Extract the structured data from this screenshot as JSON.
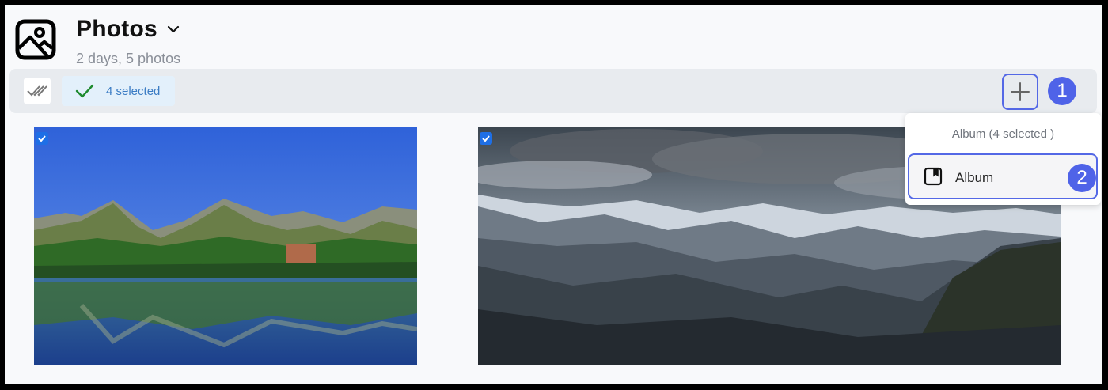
{
  "header": {
    "title": "Photos",
    "subtitle": "2 days, 5 photos",
    "app_icon": "image-icon",
    "chevron_icon": "chevron-down-icon"
  },
  "toolbar": {
    "select_all_icon": "double-check-icon",
    "selected_label": "4 selected",
    "selected_icon": "check-icon",
    "add_icon": "plus-icon",
    "step1_label": "1"
  },
  "dropdown": {
    "header": "Album (4 selected )",
    "items": [
      {
        "label": "Album",
        "icon": "bookmark-album-icon",
        "step_label": "2"
      }
    ]
  },
  "photos": [
    {
      "description_icon": "mountain-lake-photo",
      "selected": true
    },
    {
      "description_icon": "mountain-range-photo",
      "selected": true
    }
  ],
  "colors": {
    "accent": "#4f63e8",
    "selected_chip_bg": "#e3f0fb",
    "selected_text": "#3b7cc4",
    "toolbar_bg": "#e8ebef",
    "check_blue": "#1e6fe6"
  }
}
